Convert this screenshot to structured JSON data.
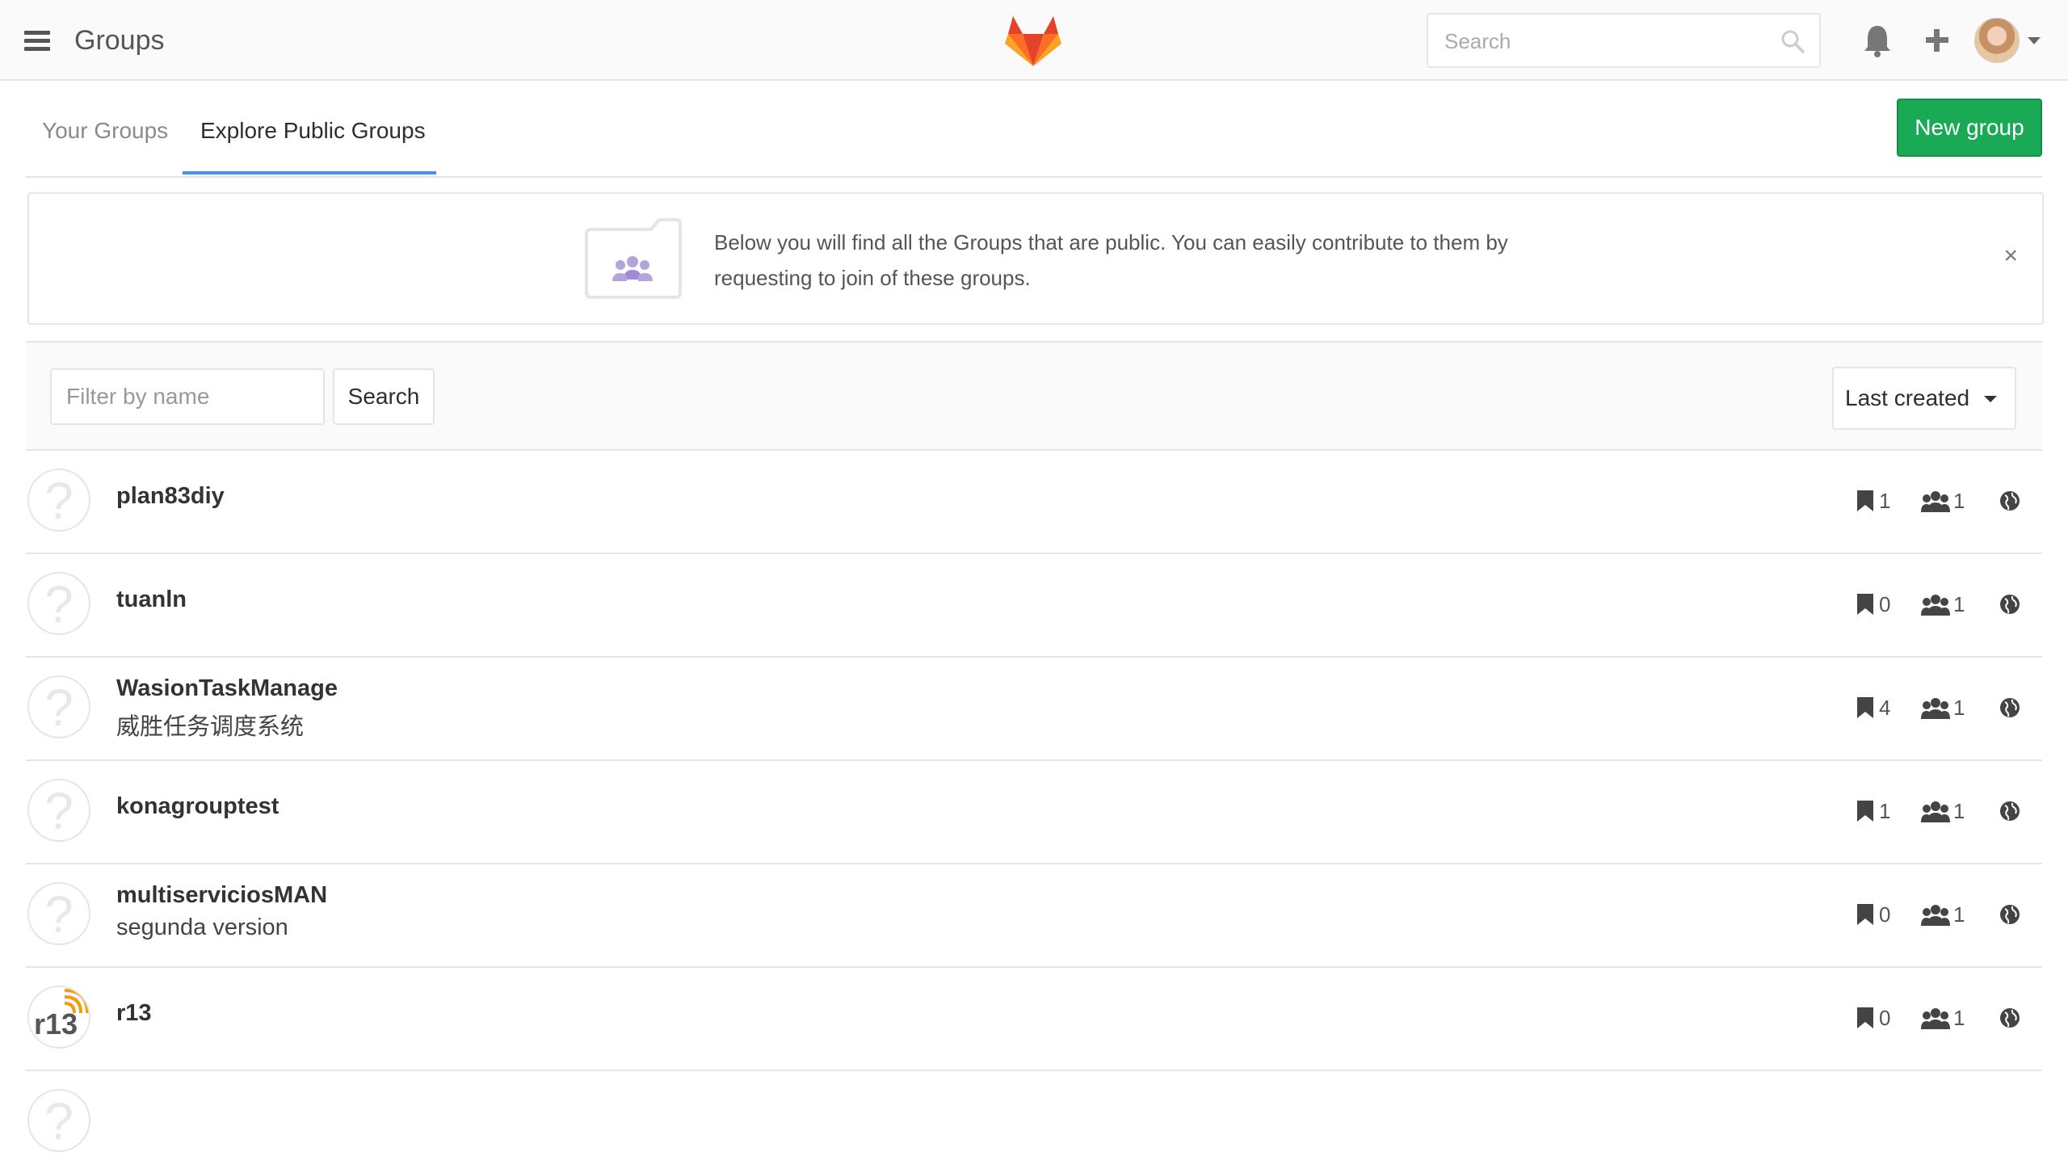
{
  "header": {
    "title": "Groups",
    "search_placeholder": "Search"
  },
  "tabs": {
    "your_groups": "Your Groups",
    "explore": "Explore Public Groups"
  },
  "actions": {
    "new_group": "New group"
  },
  "banner": {
    "text": "Below you will find all the Groups that are public. You can easily contribute to them by requesting to join of these groups.",
    "close": "×"
  },
  "filter": {
    "placeholder": "Filter by name",
    "search_label": "Search",
    "sort_label": "Last created"
  },
  "groups": [
    {
      "name": "plan83diy",
      "description": "",
      "projects": "1",
      "members": "1",
      "avatar": "question-icon"
    },
    {
      "name": "tuanln",
      "description": "",
      "projects": "0",
      "members": "1",
      "avatar": "question-icon"
    },
    {
      "name": "WasionTaskManage",
      "description": "威胜任务调度系统",
      "projects": "4",
      "members": "1",
      "avatar": "question-icon"
    },
    {
      "name": "konagrouptest",
      "description": "",
      "projects": "1",
      "members": "1",
      "avatar": "question-icon"
    },
    {
      "name": "multiserviciosMAN",
      "description": "segunda version",
      "projects": "0",
      "members": "1",
      "avatar": "question-icon"
    },
    {
      "name": "r13",
      "description": "",
      "projects": "0",
      "members": "1",
      "avatar": "r13-logo"
    }
  ],
  "colors": {
    "accent_blue": "#4a8fe8",
    "new_group_green": "#1aaa55"
  }
}
